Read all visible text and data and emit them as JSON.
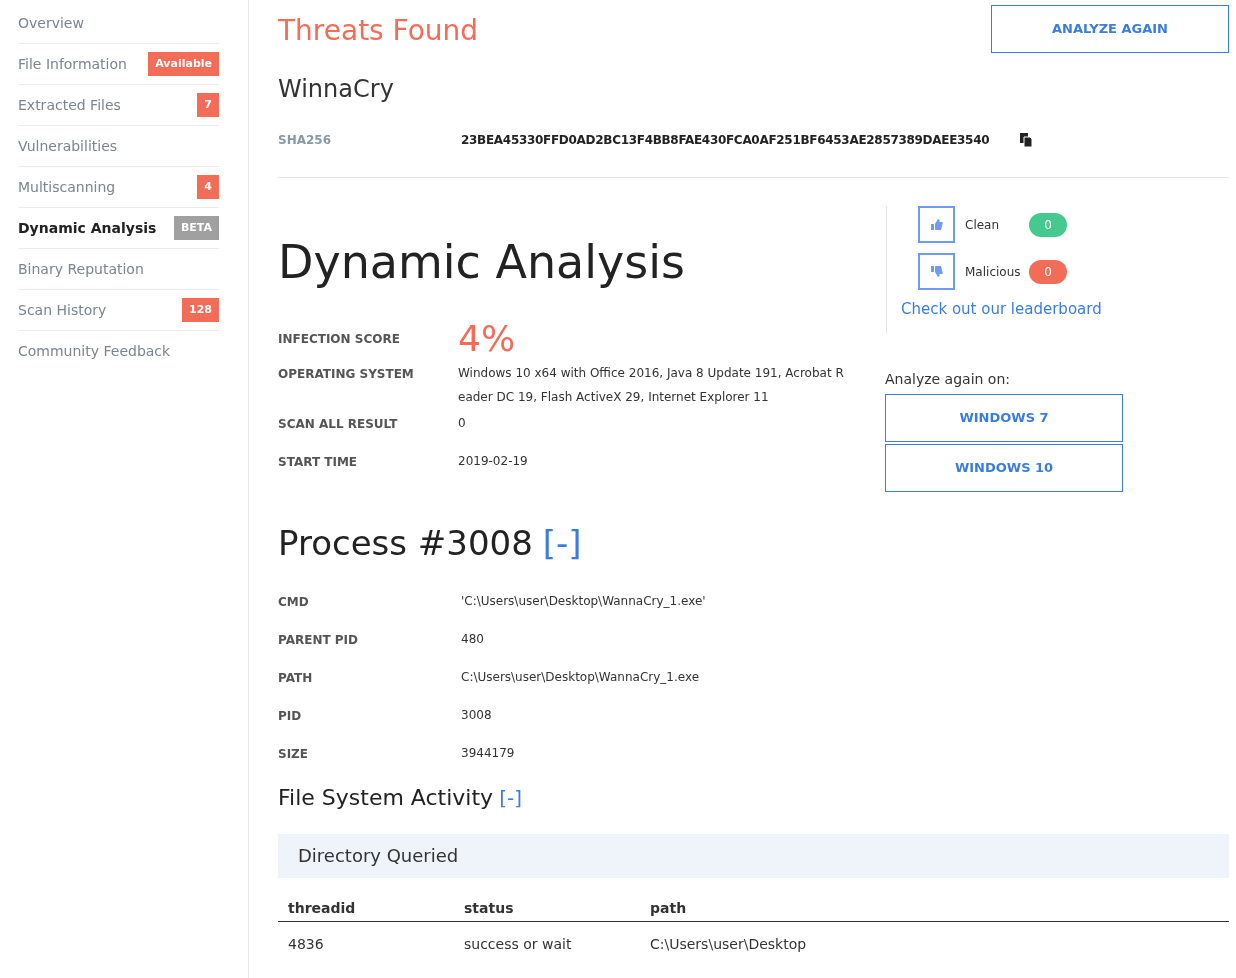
{
  "sidebar": {
    "items": [
      {
        "label": "Overview",
        "selected": false
      },
      {
        "label": "File Information",
        "selected": false,
        "badge": {
          "text": "Available",
          "color": "#f26c57"
        }
      },
      {
        "label": "Extracted Files",
        "selected": false,
        "badge": {
          "text": "7",
          "color": "#f26c57"
        }
      },
      {
        "label": "Vulnerabilities",
        "selected": false
      },
      {
        "label": "Multiscanning",
        "selected": false,
        "badge": {
          "text": "4",
          "color": "#f26c57"
        }
      },
      {
        "label": "Dynamic Analysis",
        "selected": true,
        "badge": {
          "text": "BETA",
          "color": "#a0a0a0"
        }
      },
      {
        "label": "Binary Reputation",
        "selected": false
      },
      {
        "label": "Scan History",
        "selected": false,
        "badge": {
          "text": "128",
          "color": "#f26c57"
        }
      },
      {
        "label": "Community Feedback",
        "selected": false
      }
    ]
  },
  "header": {
    "status": "Threats Found",
    "analyze_button": "ANALYZE AGAIN",
    "threat_name": "WinnaCry",
    "hash_label": "SHA256",
    "hash": "23BEA45330FFD0AD2BC13F4BB8FAE430FCA0AF251BF6453AE2857389DAEE3540"
  },
  "analysis": {
    "title": "Dynamic Analysis",
    "score_label": "INFECTION SCORE",
    "score": "4%",
    "fields": [
      {
        "label": "OPERATING SYSTEM",
        "value": "Windows 10 x64 with Office 2016, Java 8 Update 191, Acrobat Reader DC 19, Flash ActiveX 29, Internet Explorer 11"
      },
      {
        "label": "SCAN ALL RESULT",
        "value": "0"
      },
      {
        "label": "START TIME",
        "value": "2019-02-19"
      }
    ]
  },
  "votes": {
    "items": [
      {
        "kind": "up",
        "label": "Clean",
        "count": "0",
        "color": "#45c98f"
      },
      {
        "kind": "down",
        "label": "Malicious",
        "count": "0",
        "color": "#f26c57"
      }
    ],
    "link": "Check out our leaderboard"
  },
  "reanalyze": {
    "label": "Analyze again on:",
    "buttons": [
      "WINDOWS 7",
      "WINDOWS 10"
    ]
  },
  "process": {
    "title": "Process #3008",
    "toggle": "[-]",
    "fields": [
      {
        "label": "CMD",
        "value": "'C:\\Users\\user\\Desktop\\WannaCry_1.exe'"
      },
      {
        "label": "PARENT PID",
        "value": "480"
      },
      {
        "label": "PATH",
        "value": "C:\\Users\\user\\Desktop\\WannaCry_1.exe"
      },
      {
        "label": "PID",
        "value": "3008"
      },
      {
        "label": "SIZE",
        "value": "3944179"
      }
    ]
  },
  "file_system": {
    "title": "File System Activity",
    "toggle": "[-]",
    "section": "Directory Queried",
    "table": {
      "columns": [
        "threadid",
        "status",
        "path"
      ],
      "rows": [
        [
          "4836",
          "success or wait",
          "C:\\Users\\user\\Desktop"
        ]
      ]
    }
  }
}
